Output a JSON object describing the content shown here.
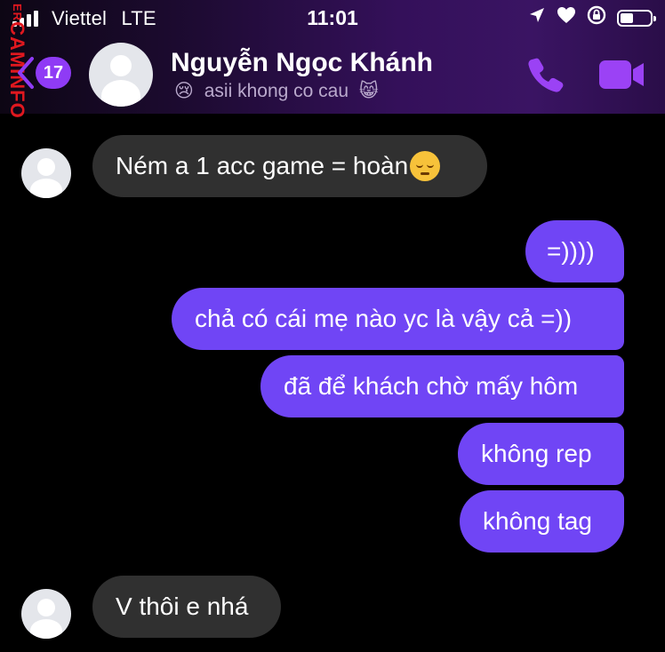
{
  "status_bar": {
    "carrier": "Viettel",
    "network": "LTE",
    "time": "11:01",
    "battery_level": 0.45
  },
  "watermark": {
    "text": "CAMINFO",
    "small": "ER"
  },
  "header": {
    "unread_count": "17",
    "contact_name": "Nguyễn Ngọc Khánh",
    "status_emoji_left": "😢",
    "status_text": "asii khong co cau",
    "status_emoji_right": "😸"
  },
  "messages": [
    {
      "direction": "incoming",
      "text": "Ném a 1 acc game = hoàn",
      "emoji": "pensive-face"
    },
    {
      "direction": "outgoing",
      "text": "=))))"
    },
    {
      "direction": "outgoing",
      "text": "chả có cái mẹ nào yc là vậy cả =))"
    },
    {
      "direction": "outgoing",
      "text": "đã để khách chờ mấy hôm"
    },
    {
      "direction": "outgoing",
      "text": "không rep"
    },
    {
      "direction": "outgoing",
      "text": "không tag"
    },
    {
      "direction": "incoming",
      "text": "V thôi e nhá"
    }
  ],
  "colors": {
    "outgoing_bubble": "#7045f5",
    "incoming_bubble": "#303030",
    "accent": "#8f3bf5",
    "watermark": "#e0181f"
  },
  "icons": {
    "back": "chevron-left-icon",
    "call": "phone-icon",
    "video": "video-camera-icon",
    "location": "location-arrow-icon",
    "heart": "heart-icon",
    "rotation_lock": "rotation-lock-icon",
    "battery": "battery-icon",
    "signal": "signal-icon"
  }
}
